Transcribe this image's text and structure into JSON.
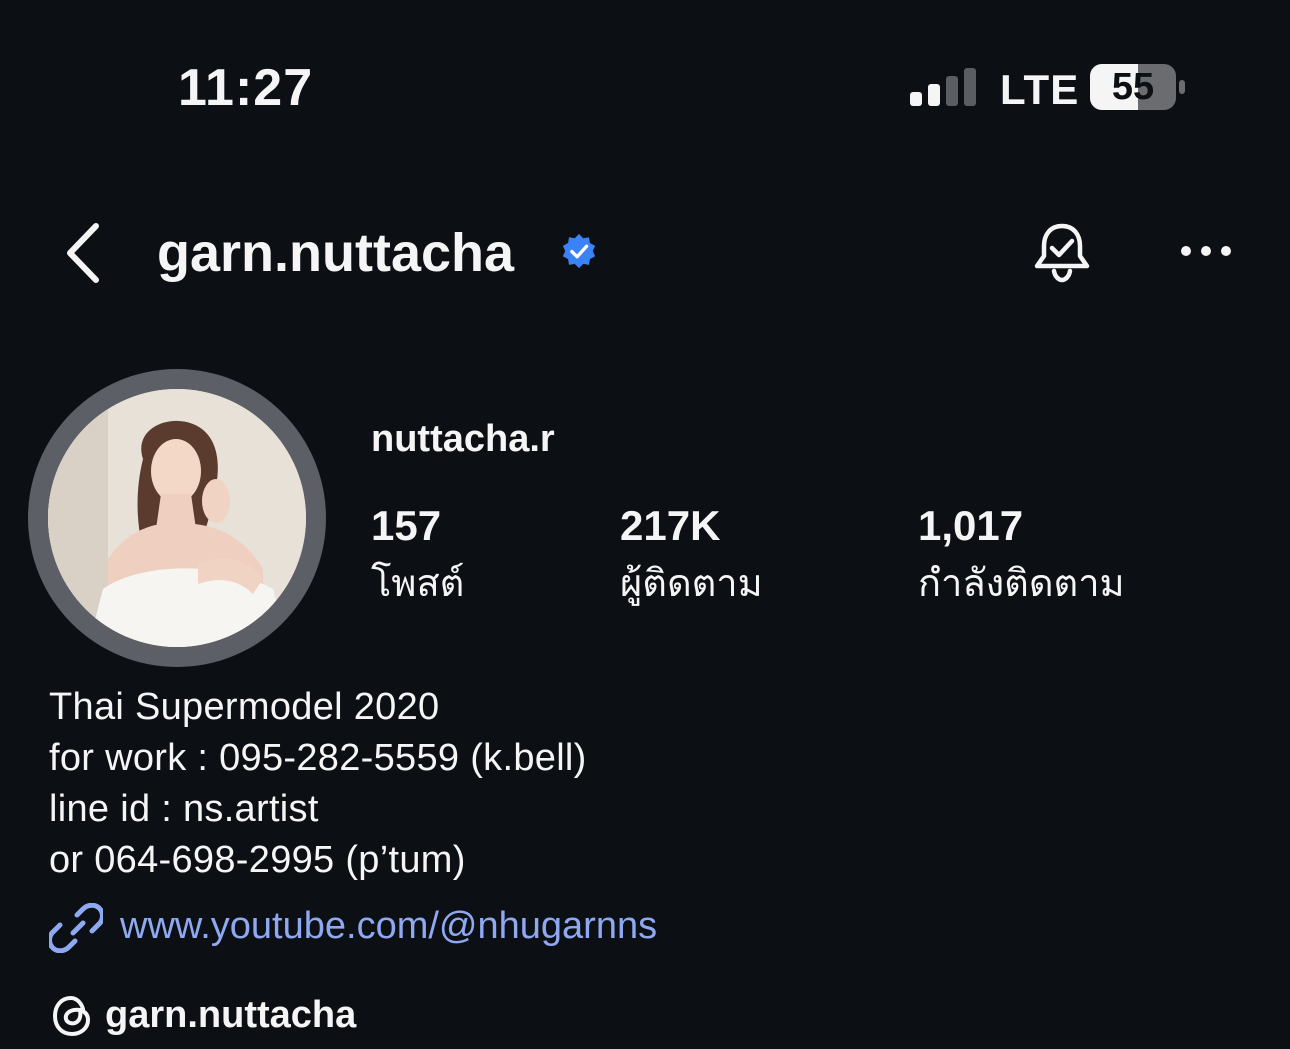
{
  "status_bar": {
    "time": "11:27",
    "network": "LTE",
    "battery": "55",
    "icons": {
      "signal": "signal-icon",
      "battery": "battery-icon"
    }
  },
  "header": {
    "username": "garn.nuttacha",
    "icons": {
      "back": "chevron-left-icon",
      "verified": "verified-badge-icon",
      "notifications": "bell-check-icon",
      "more": "more-horizontal-icon"
    }
  },
  "profile": {
    "display_name": "nuttacha.r",
    "stats": [
      {
        "value": "157",
        "label": "โพสต์"
      },
      {
        "value": "217K",
        "label": "ผู้ติดตาม"
      },
      {
        "value": "1,017",
        "label": "กำลังติดตาม"
      }
    ],
    "bio": [
      "Thai Supermodel 2020",
      "for work : 095-282-5559 (k.bell)",
      "line id : ns.artist",
      "or 064-698-2995 (p’tum)"
    ],
    "link": "www.youtube.com/@nhugarnns",
    "threads_handle": "garn.nuttacha"
  },
  "colors": {
    "background": "#0c1014",
    "text": "#f5f5f5",
    "link": "#8fa8f2",
    "verified": "#3b82f6",
    "avatar_ring": "#5c5f66"
  }
}
